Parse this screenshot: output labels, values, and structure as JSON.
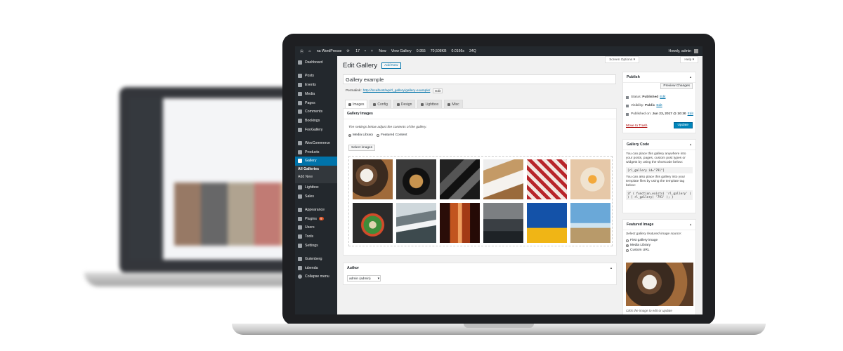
{
  "adminbar": {
    "site": "na WordPresse",
    "updates": "17",
    "new": "New",
    "view": "View Gallery",
    "stats": [
      "0.955",
      "70,508KB",
      "0.0166s",
      "34Q"
    ],
    "howdy": "Howdy, admin"
  },
  "sidebar": {
    "items": [
      {
        "label": "Dashboard"
      },
      {
        "label": "Posts"
      },
      {
        "label": "Events"
      },
      {
        "label": "Media"
      },
      {
        "label": "Pages"
      },
      {
        "label": "Comments"
      },
      {
        "label": "Bookings"
      },
      {
        "label": "FooGallery"
      },
      {
        "label": "WooCommerce"
      },
      {
        "label": "Products"
      },
      {
        "label": "Gallery"
      },
      {
        "label": "All Galleries"
      },
      {
        "label": "Add New"
      },
      {
        "label": "Lightbox"
      },
      {
        "label": "Sales"
      },
      {
        "label": "Appearance"
      },
      {
        "label": "Plugins"
      },
      {
        "label": "Users"
      },
      {
        "label": "Tools"
      },
      {
        "label": "Settings"
      },
      {
        "label": "Gutenberg"
      },
      {
        "label": "iubenda"
      },
      {
        "label": "Collapse menu"
      }
    ],
    "plugins_badge": "9"
  },
  "header": {
    "screen_options": "Screen Options ▾",
    "help": "Help ▾",
    "title": "Edit Gallery",
    "add_new": "Add New"
  },
  "post": {
    "title_value": "Gallery example",
    "permalink_label": "Permalink:",
    "permalink_url": "http://localhost/wp/rl_gallery/gallery-example/",
    "permalink_edit": "Edit"
  },
  "tabs": [
    {
      "label": "Images"
    },
    {
      "label": "Config"
    },
    {
      "label": "Design"
    },
    {
      "label": "Lightbox"
    },
    {
      "label": "Misc"
    }
  ],
  "gallery_images": {
    "heading": "Gallery Images",
    "description": "The settings below adjust the contents of the gallery.",
    "source_media": "Media Library",
    "source_featured": "Featured Content",
    "select_button": "Select images"
  },
  "author": {
    "heading": "Author",
    "selected": "admin (admin)"
  },
  "publish": {
    "heading": "Publish",
    "preview": "Preview Changes",
    "status_label": "Status:",
    "status_value": "Published",
    "visibility_label": "Visibility:",
    "visibility_value": "Public",
    "published_label": "Published on:",
    "published_value": "Jun 23, 2017 @ 10:30",
    "edit": "Edit",
    "trash": "Move to Trash",
    "update": "Update"
  },
  "gallery_code": {
    "heading": "Gallery Code",
    "text1": "You can place this gallery anywhere into your posts, pages, custom post types or widgets by using the shortcode below:",
    "shortcode": "[rl_gallery id=\"791\"]",
    "text2": "You can also place this gallery into your template files by using the template tag below:",
    "template_tag": "if ( function_exists( 'rl_gallery' ) ) { rl_gallery( '791' ); }"
  },
  "featured_image": {
    "heading": "Featured Image",
    "prompt": "Select gallery featured image source:",
    "opt_first": "First gallery image",
    "opt_media": "Media Library",
    "opt_custom": "Custom URL",
    "caption": "Click the image to edit or update"
  },
  "colors": {
    "accent": "#0073aa",
    "adminbar": "#23282d",
    "update_button": "#0085ba"
  }
}
